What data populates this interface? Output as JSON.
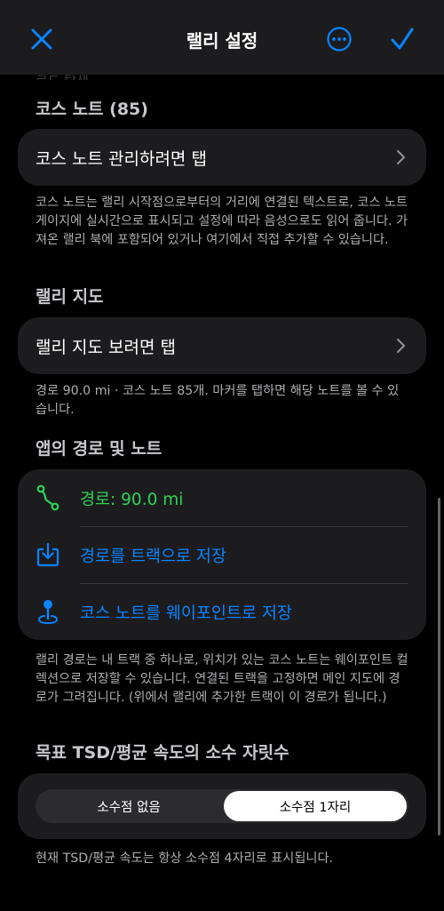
{
  "nav": {
    "title": "랠리 설정",
    "close_icon": "close-icon",
    "more_icon": "more-icon",
    "done_icon": "checkmark-icon"
  },
  "colors": {
    "accent": "#0a84ff",
    "green": "#30d158"
  },
  "peek_text": "로드 탐색 ...",
  "course_notes": {
    "header": "코스 노트 (85)",
    "manage_label": "코스 노트 관리하려면 탭",
    "footnote": "코스 노트는 랠리 시작점으로부터의 거리에 연결된 텍스트로, 코스 노트 게이지에 실시간으로 표시되고 설정에 따라 음성으로도 읽어 줍니다. 가져온 랠리 북에 포함되어 있거나 여기에서 직접 추가할 수 있습니다."
  },
  "rally_map": {
    "header": "랠리 지도",
    "view_label": "랠리 지도 보려면 탭",
    "footnote": "경로 90.0 mi · 코스 노트 85개. 마커를 탭하면 해당 노트를 볼 수 있습니다."
  },
  "app_route": {
    "header": "앱의 경로 및 노트",
    "route_label": "경로: 90.0 mi",
    "save_track_label": "경로를 트랙으로 저장",
    "save_waypoints_label": "코스 노트를 웨이포인트로 저장",
    "footnote": "랠리 경로는 내 트랙 중 하나로, 위치가 있는 코스 노트는 웨이포인트 컬렉션으로 저장할 수 있습니다. 연결된 트랙을 고정하면 메인 지도에 경로가 그려집니다. (위에서 랠리에 추가한 트랙이 이 경로가 됩니다.)"
  },
  "decimals": {
    "header": "목표 TSD/평균 속도의 소수 자릿수",
    "options": [
      "소수점 없음",
      "소수점 1자리"
    ],
    "selected": "소수점 1자리",
    "footnote": "현재 TSD/평균 속도는 항상 소수점 4자리로 표시됩니다."
  }
}
